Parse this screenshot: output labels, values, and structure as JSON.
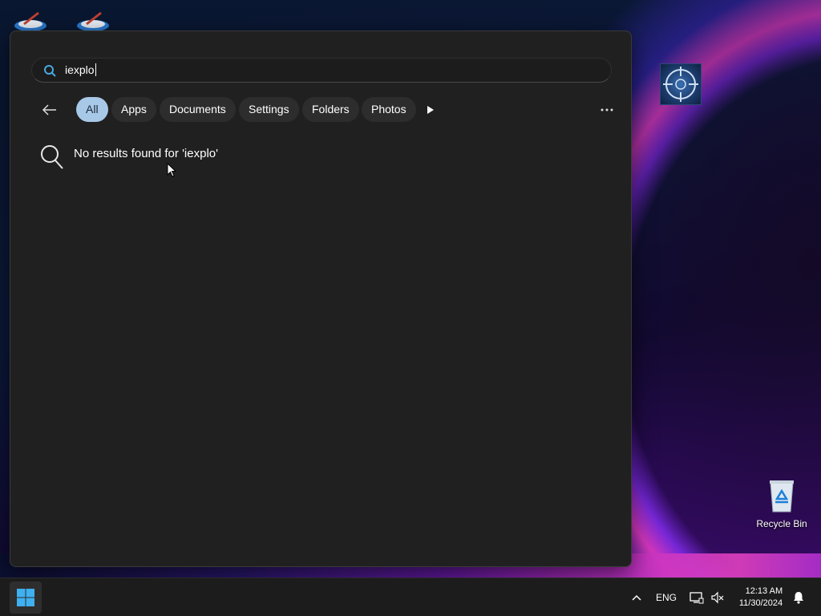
{
  "search": {
    "query": "iexplo"
  },
  "filters": {
    "chips": [
      {
        "label": "All",
        "active": true
      },
      {
        "label": "Apps",
        "active": false
      },
      {
        "label": "Documents",
        "active": false
      },
      {
        "label": "Settings",
        "active": false
      },
      {
        "label": "Folders",
        "active": false
      },
      {
        "label": "Photos",
        "active": false
      }
    ]
  },
  "results": {
    "message": "No results found for 'iexplo'"
  },
  "desktop": {
    "recycle_bin_label": "Recycle Bin"
  },
  "taskbar": {
    "language": "ENG",
    "time": "12:13 AM",
    "date": "11/30/2024"
  },
  "colors": {
    "panel_bg": "#202020",
    "active_chip": "#a8c8e8",
    "chip_bg": "#2d2d2d",
    "taskbar_bg": "#1c1c1c"
  }
}
